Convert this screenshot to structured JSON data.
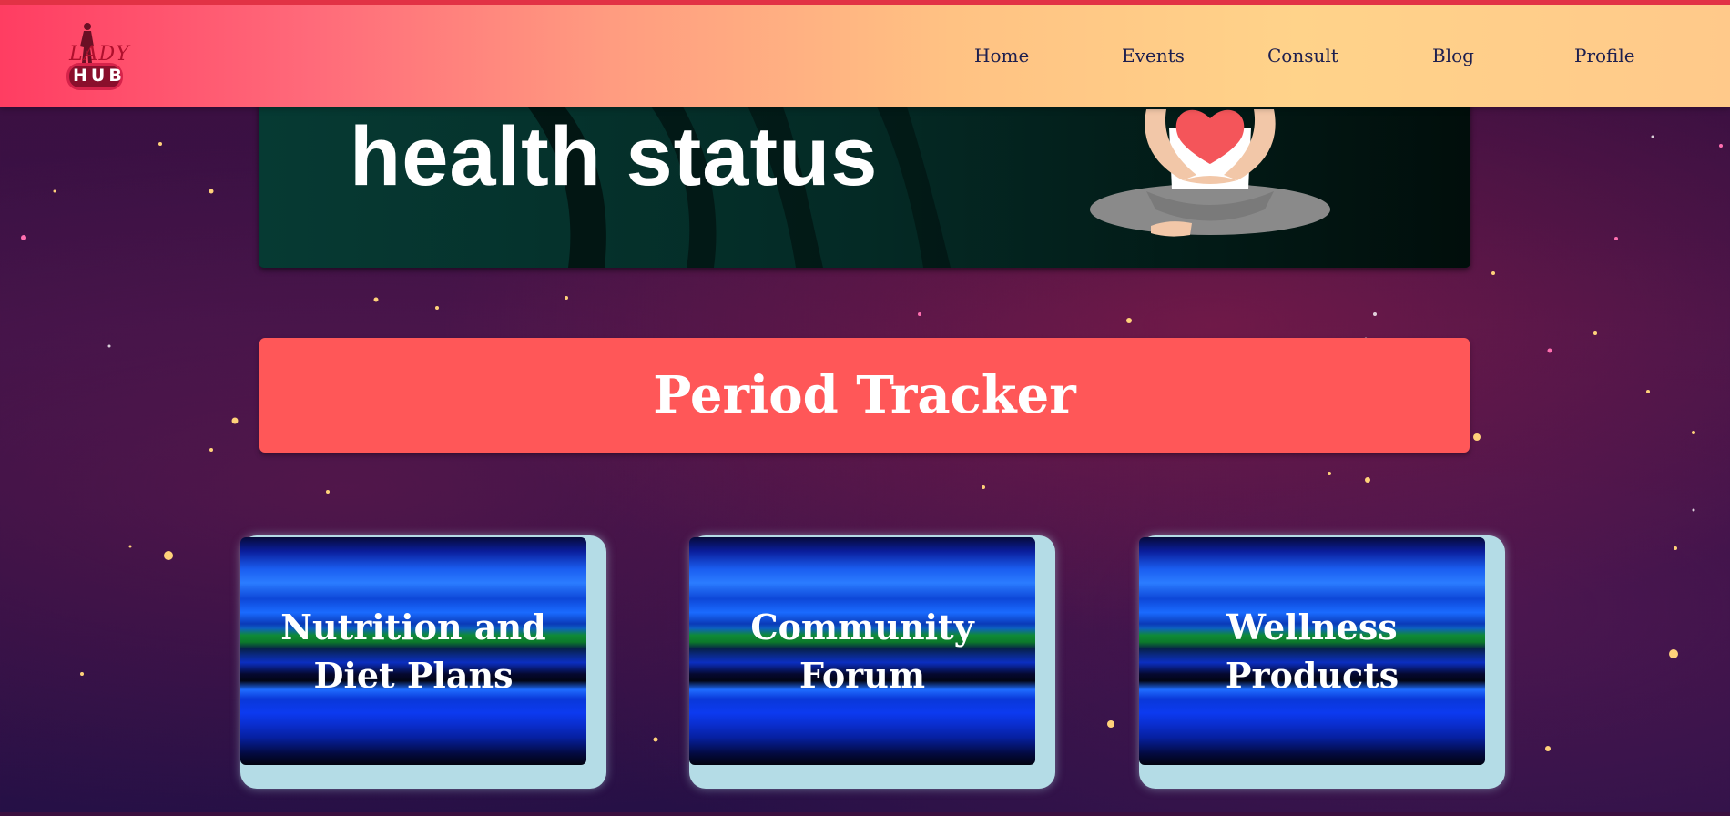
{
  "brand": {
    "logo_top": "LADY",
    "logo_bottom": "HUB"
  },
  "nav": {
    "items": [
      {
        "label": "Home"
      },
      {
        "label": "Events"
      },
      {
        "label": "Consult"
      },
      {
        "label": "Blog"
      },
      {
        "label": "Profile"
      }
    ]
  },
  "hero": {
    "title": "health status"
  },
  "tracker": {
    "label": "Period Tracker"
  },
  "cards": [
    {
      "label": "Nutrition and Diet Plans"
    },
    {
      "label": "Community Forum"
    },
    {
      "label": "Wellness Products"
    }
  ],
  "colors": {
    "header_gradient_start": "#ff3d62",
    "header_gradient_end": "#ffc98a",
    "nav_text": "#1d1f4f",
    "tracker_bg": "#ff5758",
    "card_frame": "#b4dce6",
    "hero_bg": "#021613"
  },
  "icons": {
    "logo": "lady-silhouette-logo",
    "hero_illustration": "meditating-woman-heart"
  }
}
